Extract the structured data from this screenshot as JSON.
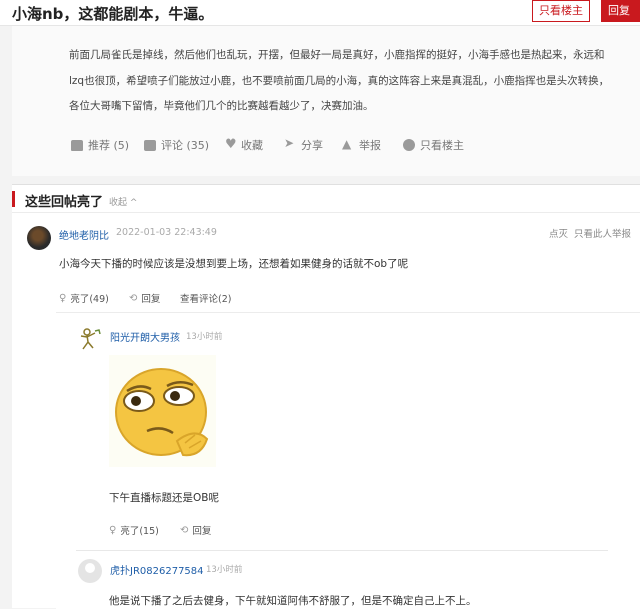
{
  "header": {
    "title": "小海nb，这都能剧本，牛逼。",
    "only_op_label": "只看楼主",
    "reply_label": "回复"
  },
  "post": {
    "text": "前面几局雀氏是掉线，然后他们也乱玩，开摆，但最好一局是真好，小鹿指挥的挺好，小海手感也是热起来，永远和lzq也很顶，希望喷子们能放过小鹿，也不要喷前面几局的小海，真的这阵容上来是真混乱，小鹿指挥也是头次转换，各位大哥嘴下留情，毕竟他们几个的比赛越看越少了，决赛加油。",
    "actions": {
      "recommend": "推荐 (5)",
      "comment": "评论 (35)",
      "favorite": "收藏",
      "share": "分享",
      "report": "举报",
      "only_op": "只看楼主"
    }
  },
  "section": {
    "title": "这些回帖亮了",
    "fold_label": "收起 ^"
  },
  "comment": {
    "user": "绝地老阴比",
    "time": "2022-01-03 22:43:49",
    "actions_right": [
      "点灭",
      "只看此人",
      "举报"
    ],
    "text": "小海今天下播的时候应该是没想到要上场，还想着如果健身的话就不ob了呢",
    "light": "亮了(49)",
    "reply": "回复",
    "view_replies": "查看评论(2)"
  },
  "replies": [
    {
      "user": "阳光开朗大男孩",
      "time": "13小时前",
      "text": "下午直播标题还是OB呢",
      "light": "亮了(15)",
      "reply": "回复"
    },
    {
      "user": "虎扑JR0826277584",
      "time": "13小时前",
      "text": "他是说下播了之后去健身，下午就知道阿伟不舒服了，但是不确定自己上不上。"
    }
  ],
  "colors": {
    "accent": "#c9191e",
    "link": "#1f5ea8"
  }
}
